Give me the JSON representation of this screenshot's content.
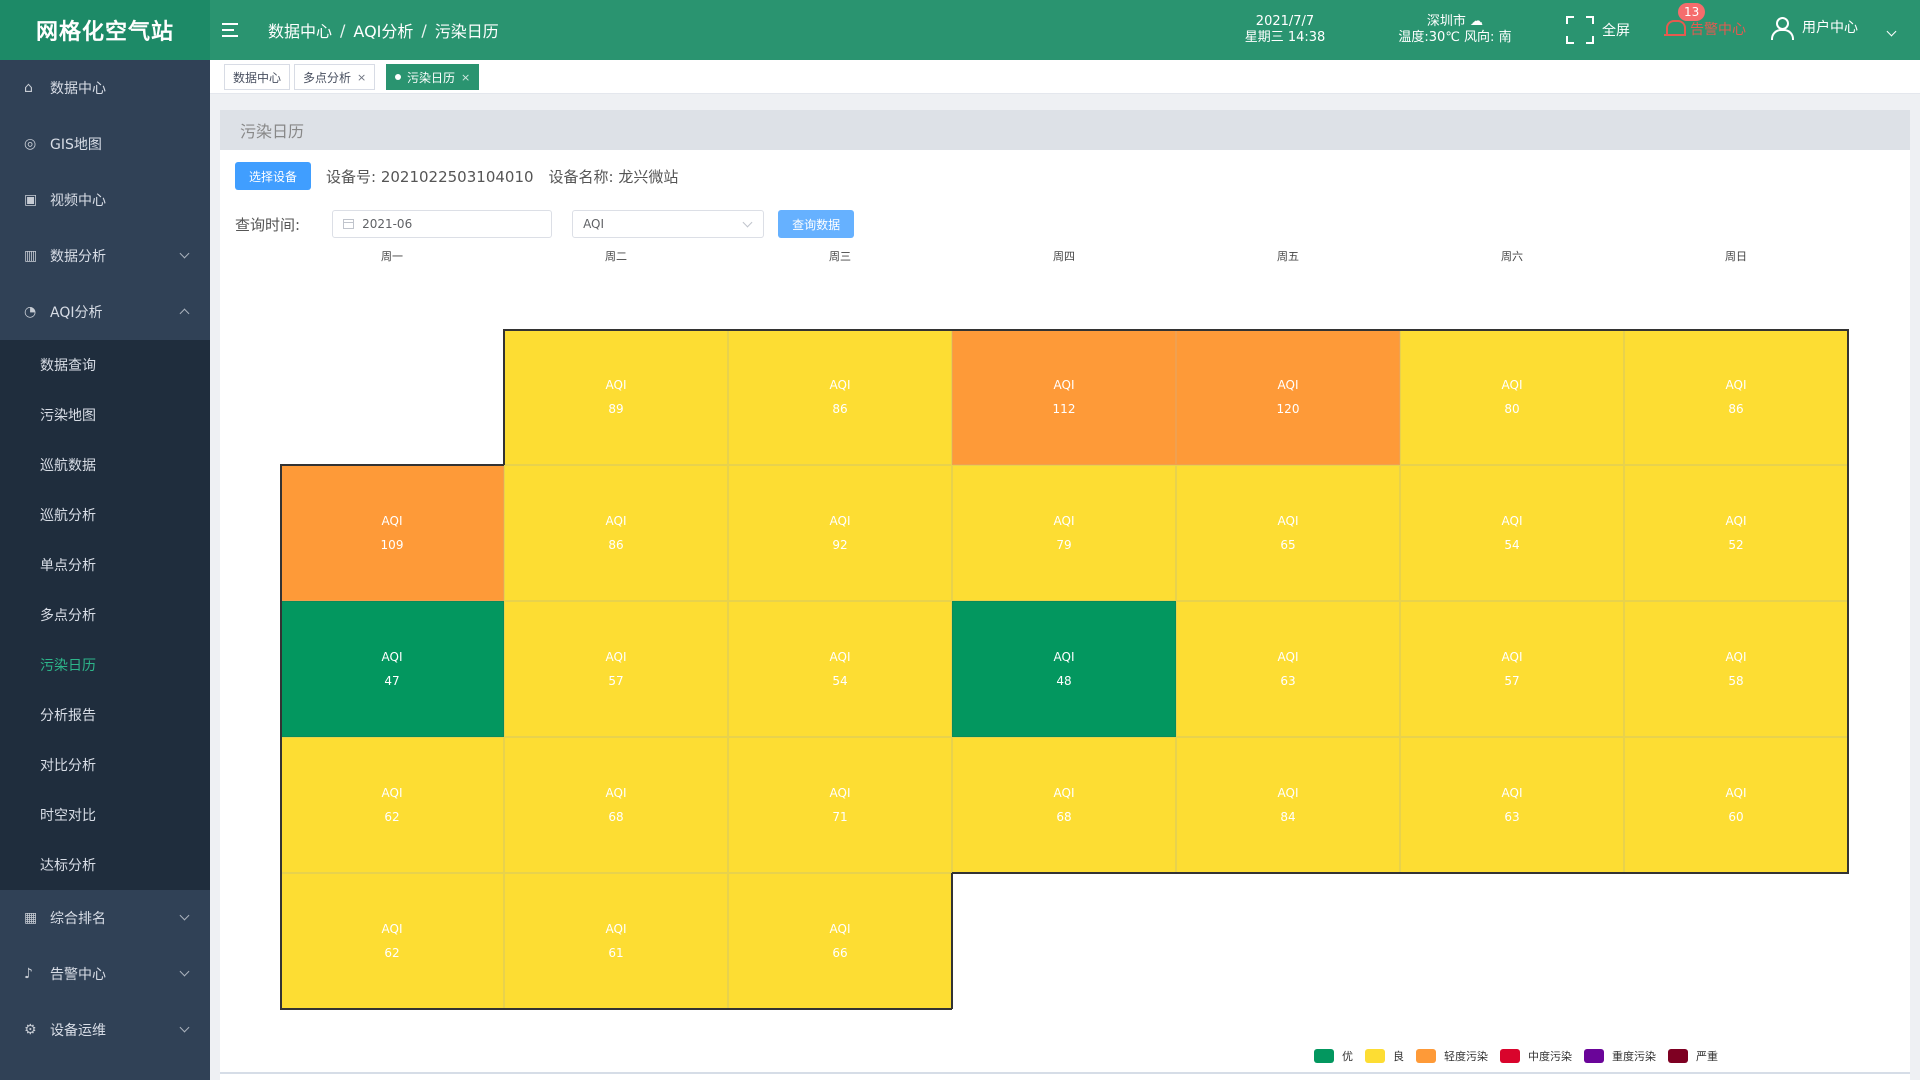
{
  "app": {
    "title": "网格化空气站"
  },
  "breadcrumb": [
    "数据中心",
    "AQI分析",
    "污染日历"
  ],
  "header": {
    "date": "2021/7/7",
    "weekday_time": "星期三 14:38",
    "city": "深圳市 ☁",
    "weather": "温度:30℃ 风向: 南",
    "fullscreen_label": "全屏",
    "alarm_label": "告警中心",
    "alarm_count": "13",
    "user_label": "用户中心"
  },
  "sidebar": {
    "items": [
      {
        "label": "数据中心",
        "icon": "home-icon"
      },
      {
        "label": "GIS地图",
        "icon": "map-pin-icon"
      },
      {
        "label": "视频中心",
        "icon": "camera-icon"
      },
      {
        "label": "数据分析",
        "icon": "bar-chart-icon",
        "expandable": true
      },
      {
        "label": "AQI分析",
        "icon": "gauge-icon",
        "expandable": true,
        "expanded": true
      }
    ],
    "sub_items": [
      "数据查询",
      "污染地图",
      "巡航数据",
      "巡航分析",
      "单点分析",
      "多点分析",
      "污染日历",
      "分析报告",
      "对比分析",
      "时空对比",
      "达标分析"
    ],
    "active_sub": "污染日历",
    "bottom_items": [
      {
        "label": "综合排名",
        "icon": "calendar-icon"
      },
      {
        "label": "告警中心",
        "icon": "bell-icon"
      },
      {
        "label": "设备运维",
        "icon": "settings-icon"
      }
    ]
  },
  "tags": [
    {
      "label": "数据中心",
      "closable": false
    },
    {
      "label": "多点分析",
      "closable": true
    },
    {
      "label": "污染日历",
      "closable": true,
      "active": true
    }
  ],
  "panel": {
    "title": "污染日历",
    "select_device_label": "选择设备",
    "device_no": "设备号: 2021022503104010",
    "device_name": "设备名称: 龙兴微站",
    "query_time_label": "查询时间:",
    "month_value": "2021-06",
    "type_value": "AQI",
    "query_button_label": "查询数据"
  },
  "calendar": {
    "weekdays": [
      "周一",
      "周二",
      "周三",
      "周四",
      "周五",
      "周六",
      "周日"
    ],
    "cell_label": "AQI",
    "month": "2021-06",
    "first_weekday_index": 1,
    "days": [
      89,
      86,
      112,
      120,
      80,
      86,
      109,
      86,
      92,
      79,
      65,
      54,
      52,
      47,
      57,
      54,
      48,
      63,
      57,
      58,
      62,
      68,
      71,
      68,
      84,
      63,
      60,
      62,
      61,
      66
    ]
  },
  "legend": [
    {
      "label": "优",
      "color": "#03975f"
    },
    {
      "label": "良",
      "color": "#fddd33"
    },
    {
      "label": "轻度污染",
      "color": "#fe9a38"
    },
    {
      "label": "中度污染",
      "color": "#d9042c"
    },
    {
      "label": "重度污染",
      "color": "#6a0599"
    },
    {
      "label": "严重",
      "color": "#7e0022"
    }
  ]
}
